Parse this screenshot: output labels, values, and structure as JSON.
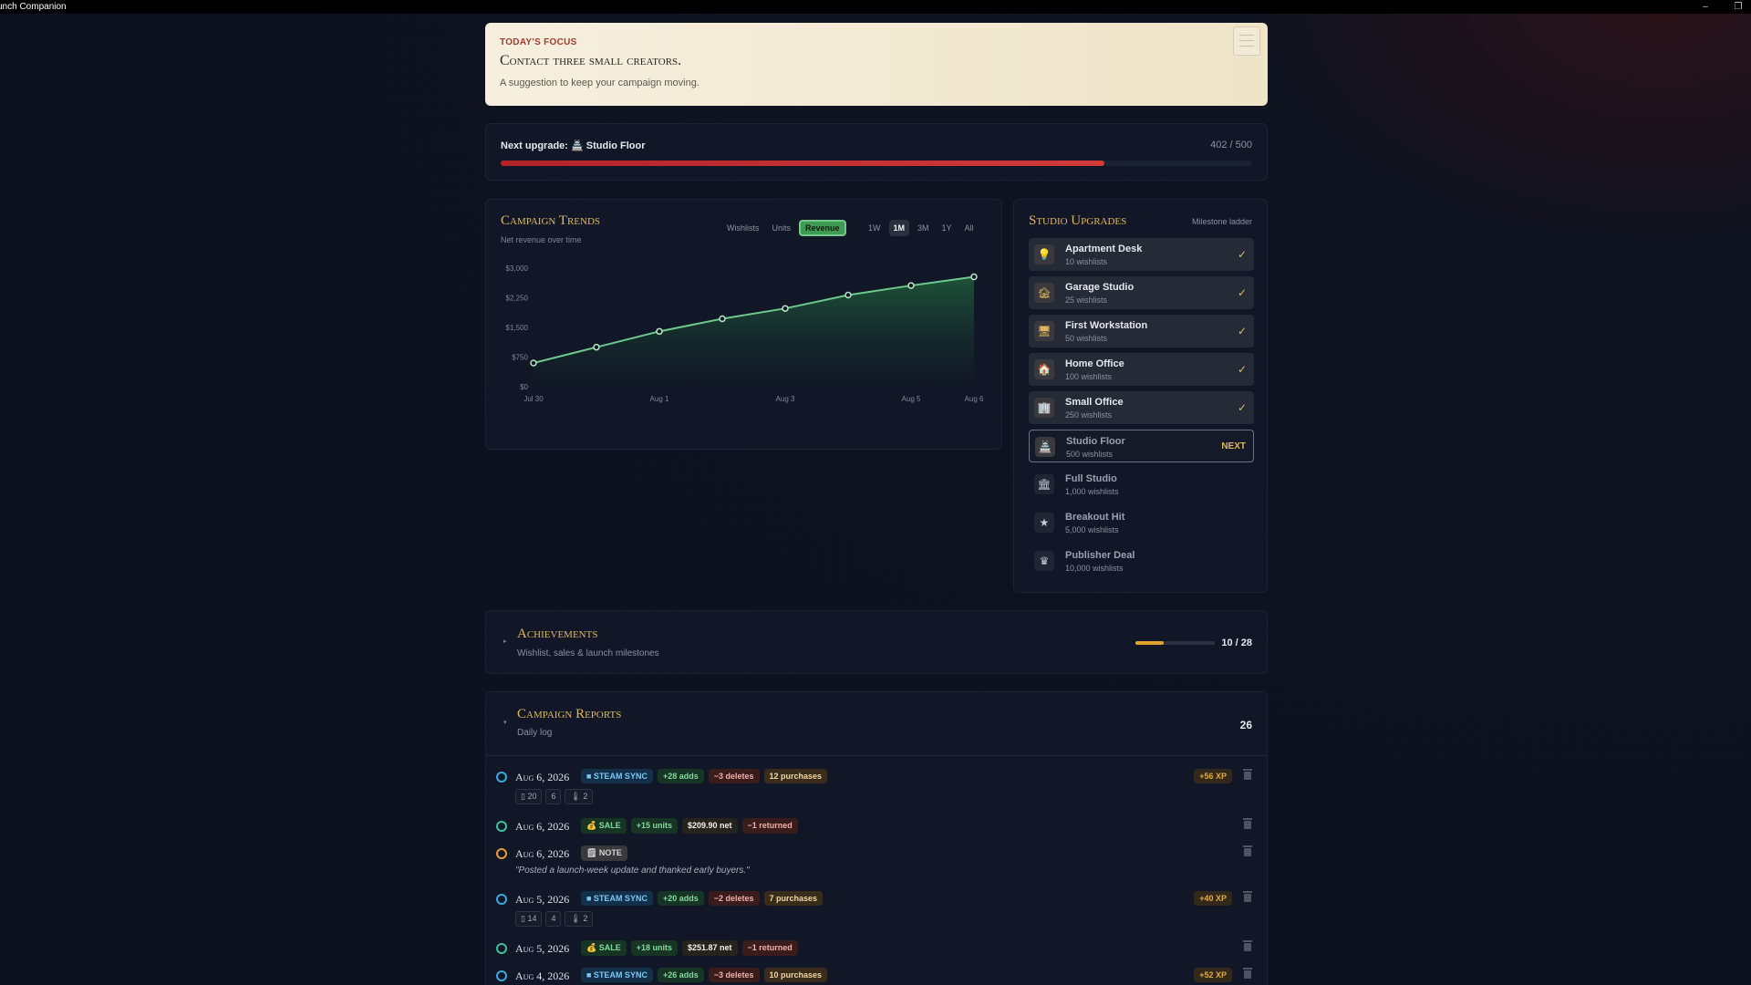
{
  "window": {
    "title": "unch Companion",
    "minimize": "–",
    "restore": "❐"
  },
  "focus": {
    "label": "TODAY'S FOCUS",
    "headline": "Contact three small creators.",
    "subtitle": "A suggestion to keep your campaign moving."
  },
  "upgrade": {
    "label": "Next upgrade: 🏯 Studio Floor",
    "count": "402 / 500",
    "progress": 0.804
  },
  "trends": {
    "title": "Campaign Trends",
    "subtitle": "Net revenue over time",
    "metric_tabs": [
      "Wishlists",
      "Units",
      "Revenue"
    ],
    "active_metric": "Revenue",
    "range_tabs": [
      "1W",
      "1M",
      "3M",
      "1Y",
      "All"
    ],
    "active_range": "1M"
  },
  "chart_data": {
    "type": "area",
    "title": "Campaign Trends",
    "subtitle": "Net revenue over time",
    "x": [
      "Jul 30",
      "Jul 31",
      "Aug 1",
      "Aug 2",
      "Aug 3",
      "Aug 4",
      "Aug 5",
      "Aug 6"
    ],
    "x_tick_labels": [
      "Jul 30",
      "Aug 1",
      "Aug 3",
      "Aug 5",
      "Aug 6"
    ],
    "y_tick_labels": [
      "$0",
      "$750",
      "$1,500",
      "$2,250",
      "$3,000"
    ],
    "ylim": [
      0,
      3000
    ],
    "series": [
      {
        "values": [
          600,
          1000,
          1400,
          1720,
          1980,
          2320,
          2560,
          2780
        ]
      }
    ],
    "grid": false,
    "colors": {
      "line": "#6cc98a",
      "area_top": "#1f5a3a",
      "area_bottom": "#111726"
    }
  },
  "studio": {
    "title": "Studio Upgrades",
    "subtitle": "Milestone ladder",
    "items": [
      {
        "name": "Apartment Desk",
        "req": "10 wishlists",
        "status": "✓",
        "state": "done",
        "icon": "lightbulb-icon",
        "glyph": "💡"
      },
      {
        "name": "Garage Studio",
        "req": "25 wishlists",
        "status": "✓",
        "state": "done",
        "icon": "garage-icon",
        "glyph": "🏚"
      },
      {
        "name": "First Workstation",
        "req": "50 wishlists",
        "status": "✓",
        "state": "done",
        "icon": "monitor-icon",
        "glyph": "🖥"
      },
      {
        "name": "Home Office",
        "req": "100 wishlists",
        "status": "✓",
        "state": "done",
        "icon": "house-icon",
        "glyph": "🏠"
      },
      {
        "name": "Small Office",
        "req": "250 wishlists",
        "status": "✓",
        "state": "done",
        "icon": "office-icon",
        "glyph": "🏢"
      },
      {
        "name": "Studio Floor",
        "req": "500 wishlists",
        "status": "NEXT",
        "state": "next",
        "icon": "studio-icon",
        "glyph": "🏯"
      },
      {
        "name": "Full Studio",
        "req": "1,000 wishlists",
        "status": "",
        "state": "locked",
        "icon": "building-icon",
        "glyph": "🏛"
      },
      {
        "name": "Breakout Hit",
        "req": "5,000 wishlists",
        "status": "",
        "state": "locked",
        "icon": "star-icon",
        "glyph": "★"
      },
      {
        "name": "Publisher Deal",
        "req": "10,000 wishlists",
        "status": "",
        "state": "locked",
        "icon": "crown-icon",
        "glyph": "♛"
      }
    ]
  },
  "achievements": {
    "title": "Achievements",
    "subtitle": "Wishlist, sales & launch milestones",
    "count": "10 / 28",
    "progress": 0.357
  },
  "reports": {
    "title": "Campaign Reports",
    "subtitle": "Daily log",
    "count": "26",
    "entries": [
      {
        "date": "Aug 6, 2026",
        "kind": "sync",
        "type": "STEAM SYNC",
        "chips": [
          [
            "+28 adds",
            "green"
          ],
          [
            "−3 deletes",
            "red"
          ],
          [
            "12 purchases",
            "tan"
          ]
        ],
        "sub": [
          "▯ 20",
          "6",
          "🌡 2"
        ],
        "xp": "+56 XP"
      },
      {
        "date": "Aug 6, 2026",
        "kind": "sale",
        "type": "SALE",
        "chips": [
          [
            "+15 units",
            "green"
          ],
          [
            "$209.90 net",
            "white"
          ],
          [
            "−1 returned",
            "red"
          ]
        ]
      },
      {
        "date": "Aug 6, 2026",
        "kind": "note",
        "type": "NOTE",
        "chips": [],
        "quote": "\"Posted a launch-week update and thanked early buyers.\""
      },
      {
        "date": "Aug 5, 2026",
        "kind": "sync",
        "type": "STEAM SYNC",
        "chips": [
          [
            "+20 adds",
            "green"
          ],
          [
            "−2 deletes",
            "red"
          ],
          [
            "7 purchases",
            "tan"
          ]
        ],
        "sub": [
          "▯ 14",
          "4",
          "🌡 2"
        ],
        "xp": "+40 XP"
      },
      {
        "date": "Aug 5, 2026",
        "kind": "sale",
        "type": "SALE",
        "chips": [
          [
            "+18 units",
            "green"
          ],
          [
            "$251.87 net",
            "white"
          ],
          [
            "−1 returned",
            "red"
          ]
        ]
      },
      {
        "date": "Aug 4, 2026",
        "kind": "sync",
        "type": "STEAM SYNC",
        "chips": [
          [
            "+26 adds",
            "green"
          ],
          [
            "−3 deletes",
            "red"
          ],
          [
            "10 purchases",
            "tan"
          ]
        ],
        "xp": "+52 XP"
      }
    ]
  }
}
